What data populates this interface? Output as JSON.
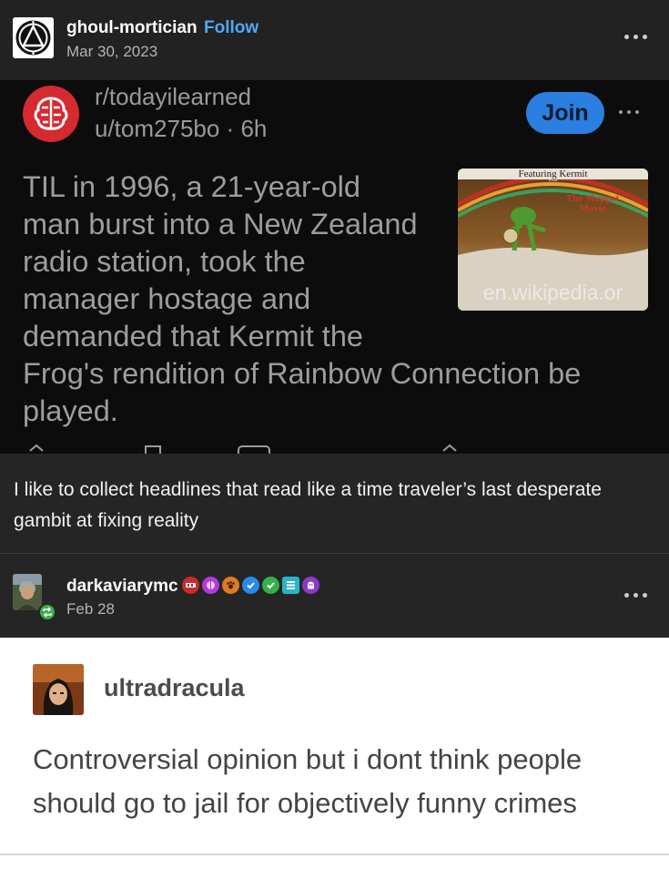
{
  "post": {
    "username": "ghoul-mortician",
    "follow_label": "Follow",
    "date": "Mar 30, 2023",
    "avatar_icon": "triangle-circle-logo-icon",
    "more_icon": "more-dots-icon"
  },
  "reddit": {
    "subreddit": "r/todayilearned",
    "user": "u/tom275bo",
    "time": "6h",
    "join_label": "Join",
    "title": "TIL in 1996, a 21-year-old man burst into a New Zealand radio station, took the manager hostage and demanded that Kermit the Frog's rendition of Rainbow Connection be played.",
    "thumbnail": {
      "top_text": "Featuring Kermit",
      "from_text": "from",
      "movie_title": "The Muppet Movie",
      "link": "en.wikipedia.or"
    },
    "colors": {
      "subreddit_icon": "#d52a30",
      "join_button": "#2a7fe0"
    }
  },
  "caption": {
    "text": "I like to collect headlines that read like a time traveler’s last desperate gambit at fixing reality"
  },
  "reblog": {
    "username": "darkaviarymc",
    "date": "Feb 28",
    "badge_icons": [
      "fire-badge-icon",
      "brain-badge-icon",
      "paw-badge-icon",
      "blue-check-badge-icon",
      "green-check-badge-icon",
      "stack-badge-icon",
      "ghost-badge-icon"
    ],
    "reblog_icon": "reblog-icon"
  },
  "quoted_post": {
    "username": "ultradracula",
    "text": "Controversial opinion but i dont think people should go to jail for objectively funny crimes"
  },
  "colors": {
    "accent_blue": "#4ea8f6",
    "reblog_green": "#3cb04a",
    "background": "#1e1e1e"
  }
}
